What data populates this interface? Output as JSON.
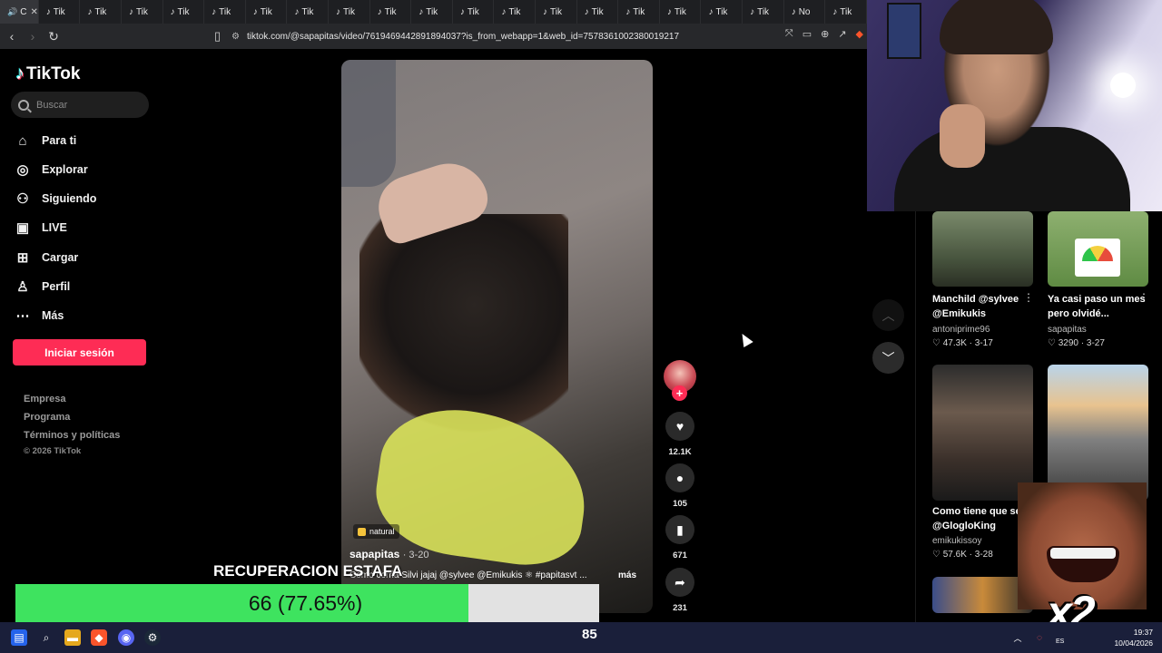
{
  "browser": {
    "active_tab_label": "C",
    "tabs": [
      "Tik",
      "Tik",
      "Tik",
      "Tik",
      "Tik",
      "Tik",
      "Tik",
      "Tik",
      "Tik",
      "Tik",
      "Tik",
      "Tik",
      "Tik",
      "Tik",
      "Tik",
      "Tik",
      "Tik",
      "Tik",
      "No",
      "Tik"
    ],
    "url": "tiktok.com/@sapapitas/video/7619469442891894037?is_from_webapp=1&web_id=7578361002380019217"
  },
  "sidebar": {
    "logo": "TikTok",
    "search_placeholder": "Buscar",
    "items": [
      {
        "label": "Para ti",
        "icon": "home-icon"
      },
      {
        "label": "Explorar",
        "icon": "compass-icon"
      },
      {
        "label": "Siguiendo",
        "icon": "following-icon"
      },
      {
        "label": "LIVE",
        "icon": "live-icon"
      },
      {
        "label": "Cargar",
        "icon": "upload-icon"
      },
      {
        "label": "Perfil",
        "icon": "profile-icon"
      },
      {
        "label": "Más",
        "icon": "more-icon"
      }
    ],
    "login_label": "Iniciar sesión",
    "footer": [
      "Empresa",
      "Programa",
      "Términos y políticas"
    ],
    "copyright": "© 2026 TikTok"
  },
  "video": {
    "tag": "natural",
    "author": "sapapitas",
    "date": "· 3-20",
    "caption": "Como corria Silvi jajaj @sylvee @Emikukis ⚛ #papitasvt ...",
    "more_label": "más",
    "likes": "12.1K",
    "comments": "105",
    "saves": "671",
    "shares": "231"
  },
  "related": [
    {
      "title": "Manchild @sylvee @Emikukis",
      "author": "antoniprime96",
      "likes": "47.3K",
      "date": "3-17"
    },
    {
      "title": "Ya casi paso un mes pero olvidé...",
      "author": "sapapitas",
      "likes": "3290",
      "date": "3-27"
    },
    {
      "title": "Como tiene que ser @GlogloKing",
      "author": "emikukissoy",
      "likes": "57.6K",
      "date": "3-28"
    }
  ],
  "overlay": {
    "label": "RECUPERACION ESTAFA",
    "progress_text": "66 (77.65%)",
    "progress_fraction": 0.7765,
    "multiplier": "x2"
  },
  "taskbar": {
    "center_number": "85",
    "lang": "ES",
    "time": "19:37",
    "date": "10/04/2026"
  },
  "colors": {
    "accent": "#fe2c55",
    "progress_fill": "#3ee35f",
    "progress_track": "#e2e2e2"
  }
}
